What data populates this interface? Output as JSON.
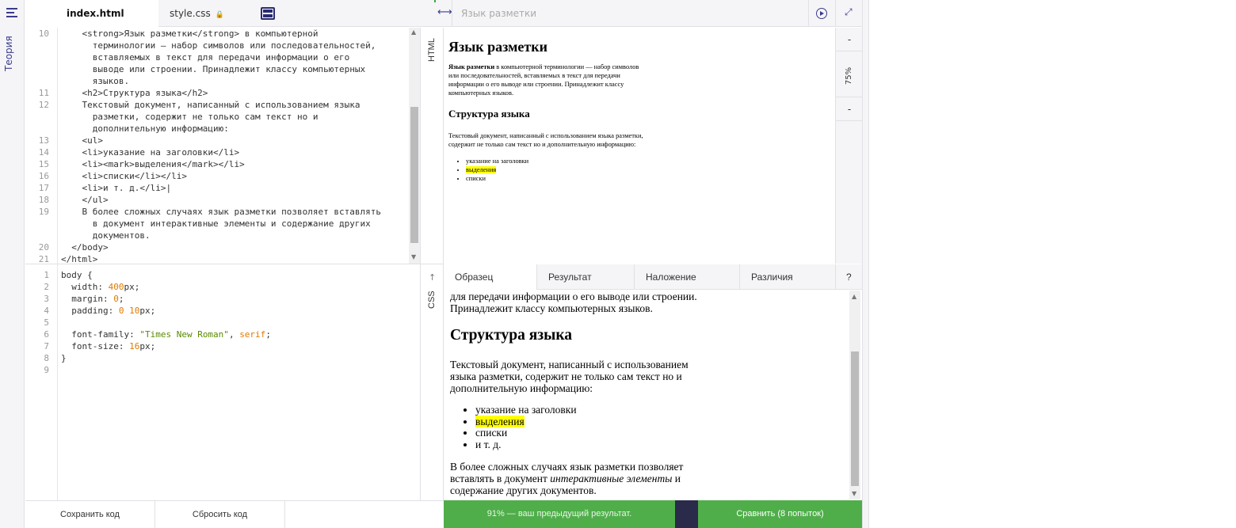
{
  "sidebar": {
    "theory_label": "Теория"
  },
  "tabs": [
    {
      "label": "index.html"
    },
    {
      "label": "style.css"
    }
  ],
  "preview_title": "Язык разметки",
  "html_label": "HTML",
  "css_label": "CSS",
  "zoom": {
    "minus": "-",
    "level": "75%",
    "plus": "-"
  },
  "html_lines": [
    {
      "num": "10",
      "text": "    <strong>Язык разметки</strong> в компьютерной"
    },
    {
      "num": "",
      "text": "      терминологии — набор символов или последовательностей,"
    },
    {
      "num": "",
      "text": "      вставляемых в текст для передачи информации о его"
    },
    {
      "num": "",
      "text": "      выводе или строении. Принадлежит классу компьютерных"
    },
    {
      "num": "",
      "text": "      языков."
    },
    {
      "num": "11",
      "text": "    <h2>Структура языка</h2>"
    },
    {
      "num": "12",
      "text": "    Текстовый документ, написанный с использованием языка"
    },
    {
      "num": "",
      "text": "      разметки, содержит не только сам текст но и"
    },
    {
      "num": "",
      "text": "      дополнительную информацию:"
    },
    {
      "num": "13",
      "text": "    <ul>"
    },
    {
      "num": "14",
      "text": "    <li>указание на заголовки</li>"
    },
    {
      "num": "15",
      "text": "    <li><mark>выделения</mark></li>"
    },
    {
      "num": "16",
      "text": "    <li>списки</li></li>"
    },
    {
      "num": "17",
      "text": "    <li>и т. д.</li>|"
    },
    {
      "num": "18",
      "text": "    </ul>"
    },
    {
      "num": "19",
      "text": "    В более сложных случаях язык разметки позволяет вставлять"
    },
    {
      "num": "",
      "text": "      в документ интерактивные элементы и содержание других"
    },
    {
      "num": "",
      "text": "      документов."
    },
    {
      "num": "20",
      "text": "  </body>"
    },
    {
      "num": "21",
      "text": "</html>"
    }
  ],
  "css_lines": [
    {
      "num": "1",
      "parts": [
        [
          "k",
          "body {"
        ]
      ]
    },
    {
      "num": "2",
      "parts": [
        [
          "k",
          "  width: "
        ],
        [
          "n",
          "400"
        ],
        [
          "k",
          "px;"
        ]
      ]
    },
    {
      "num": "3",
      "parts": [
        [
          "k",
          "  margin: "
        ],
        [
          "n",
          "0"
        ],
        [
          "k",
          ";"
        ]
      ]
    },
    {
      "num": "4",
      "parts": [
        [
          "k",
          "  padding: "
        ],
        [
          "n",
          "0 10"
        ],
        [
          "k",
          "px;"
        ]
      ]
    },
    {
      "num": "5",
      "parts": [
        [
          "k",
          ""
        ]
      ]
    },
    {
      "num": "6",
      "parts": [
        [
          "k",
          "  font-family: "
        ],
        [
          "s",
          "\"Times New Roman\""
        ],
        [
          "k",
          ", "
        ],
        [
          "n",
          "serif"
        ],
        [
          "k",
          ";"
        ]
      ]
    },
    {
      "num": "7",
      "parts": [
        [
          "k",
          "  font-size: "
        ],
        [
          "n",
          "16"
        ],
        [
          "k",
          "px;"
        ]
      ]
    },
    {
      "num": "8",
      "parts": [
        [
          "k",
          "}"
        ]
      ]
    },
    {
      "num": "9",
      "parts": [
        [
          "k",
          ""
        ]
      ]
    }
  ],
  "preview": {
    "h1": "Язык разметки",
    "p1_strong": "Язык разметки",
    "p1_rest": " в компьютерной терминологии — набор символов или последовательностей, вставляемых в текст для передачи информации о его выводе или строении. Принадлежит классу компьютерных языков.",
    "h2": "Структура языка",
    "p2": "Текстовый документ, написанный с использованием языка разметки, содержит не только сам текст но и дополнительную информацию:",
    "li1": "указание на заголовки",
    "li2": "выделения",
    "li3": "списки"
  },
  "compare_tabs": [
    "Образец",
    "Результат",
    "Наложение",
    "Различия",
    "?"
  ],
  "result": {
    "p1_tail": "для передачи информации о его выводе или строении. Принадлежит классу компьютерных языков.",
    "h2": "Структура языка",
    "p2": "Текстовый документ, написанный с использованием языка разметки, содержит не только сам текст но и дополнительную информацию:",
    "li1": "указание на заголовки",
    "li2": "выделения",
    "li3": "списки",
    "li4": "и т. д.",
    "p3_a": "В более сложных случаях язык разметки позволяет вставлять в документ ",
    "p3_em": "интерактивные элементы",
    "p3_b": " и содержание других документов."
  },
  "buttons": {
    "save": "Сохранить код",
    "reset": "Сбросить код"
  },
  "status_text": "91% — ваш предыдущий результат.",
  "compare_button": "Сравнить (8 попыток)"
}
